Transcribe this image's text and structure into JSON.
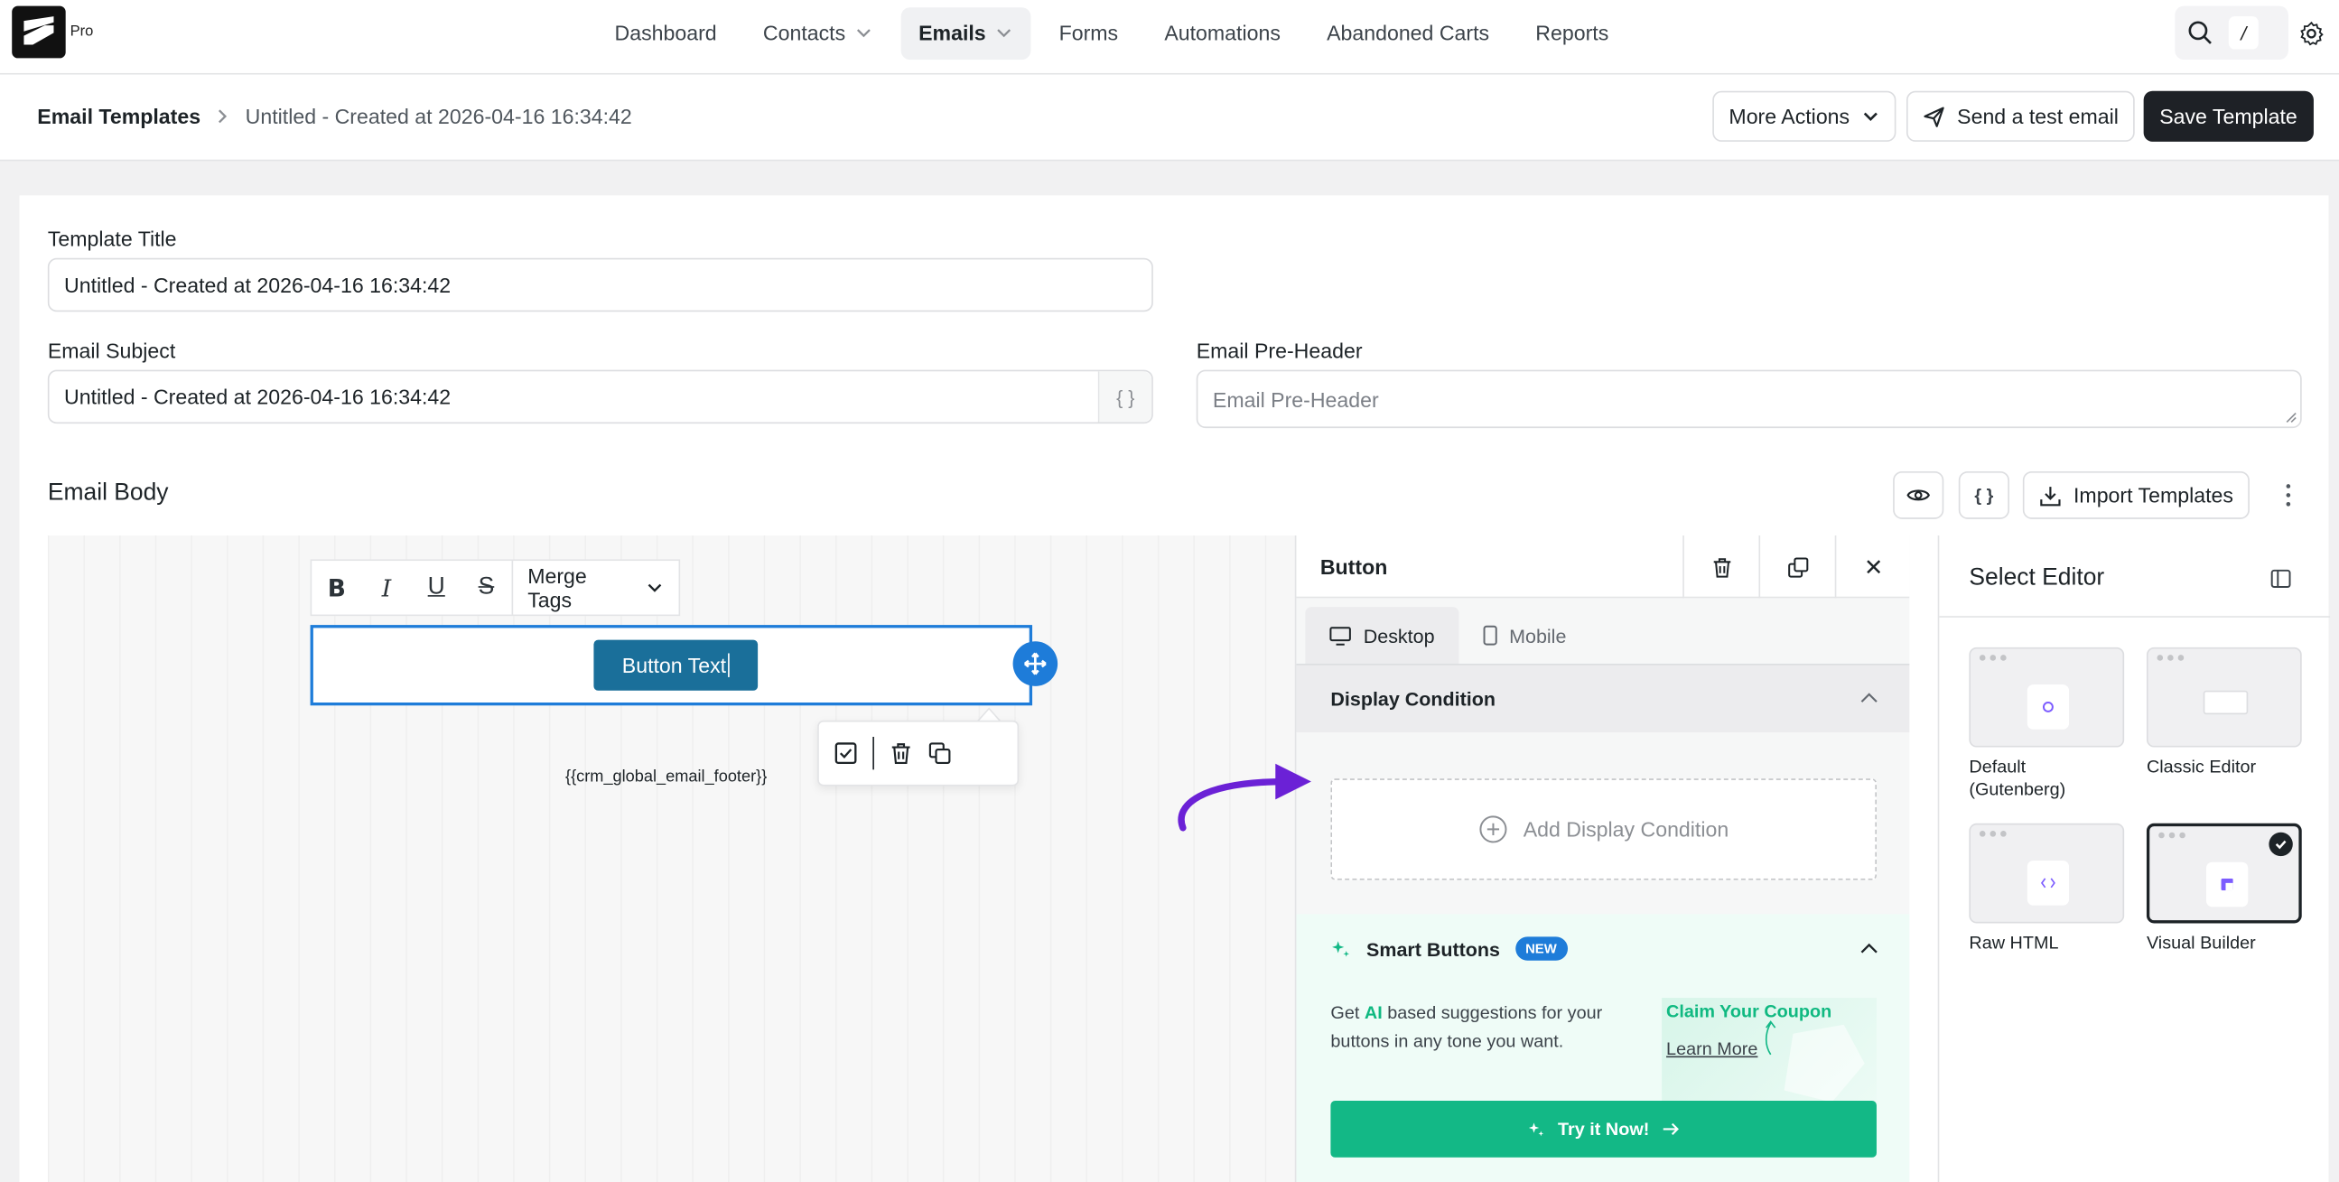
{
  "nav": {
    "logo_badge": "Pro",
    "items": [
      {
        "label": "Dashboard",
        "has_dropdown": false,
        "active": false
      },
      {
        "label": "Contacts",
        "has_dropdown": true,
        "active": false
      },
      {
        "label": "Emails",
        "has_dropdown": true,
        "active": true
      },
      {
        "label": "Forms",
        "has_dropdown": false,
        "active": false
      },
      {
        "label": "Automations",
        "has_dropdown": false,
        "active": false
      },
      {
        "label": "Abandoned Carts",
        "has_dropdown": false,
        "active": false
      },
      {
        "label": "Reports",
        "has_dropdown": false,
        "active": false
      }
    ],
    "shortcut_key": "/"
  },
  "header": {
    "breadcrumb_root": "Email Templates",
    "breadcrumb_current": "Untitled - Created at 2026-04-16 16:34:42",
    "more_actions": "More Actions",
    "send_test": "Send a test email",
    "save": "Save Template"
  },
  "form": {
    "template_title_label": "Template Title",
    "template_title_value": "Untitled - Created at 2026-04-16 16:34:42",
    "subject_label": "Email Subject",
    "subject_value": "Untitled - Created at 2026-04-16 16:34:42",
    "subject_suffix": "{ }",
    "preheader_label": "Email Pre-Header",
    "preheader_placeholder": "Email Pre-Header"
  },
  "body": {
    "title": "Email Body",
    "code_icon_label": "{ }",
    "import_label": "Import Templates"
  },
  "canvas": {
    "toolbar": [
      "B",
      "I",
      "U",
      "S"
    ],
    "merge_tags": "Merge Tags",
    "button_text": "Button Text",
    "footer_tag": "{{crm_global_email_footer}}"
  },
  "settings": {
    "title": "Button",
    "tabs": [
      {
        "label": "Desktop",
        "active": true
      },
      {
        "label": "Mobile",
        "active": false
      }
    ],
    "display_condition": "Display Condition",
    "add_condition": "Add Display Condition",
    "smart_title": "Smart Buttons",
    "new_badge": "NEW",
    "smart_desc_pre": "Get ",
    "smart_desc_ai": "AI",
    "smart_desc_post": " based suggestions for your buttons in any tone you want.",
    "preview_claim": "Claim Your Coupon",
    "preview_learn": "Learn More",
    "try_now": "Try it Now!"
  },
  "editor_select": {
    "title": "Select Editor",
    "options": [
      {
        "label": "Default (Gutenberg)",
        "selected": false
      },
      {
        "label": "Classic Editor",
        "selected": false
      },
      {
        "label": "Raw HTML",
        "selected": false
      },
      {
        "label": "Visual Builder",
        "selected": true
      }
    ]
  },
  "colors": {
    "accent_blue": "#1e7cd9",
    "email_button": "#1a6f9a",
    "smart_green": "#13b886",
    "arrow_purple": "#6b21d6"
  }
}
